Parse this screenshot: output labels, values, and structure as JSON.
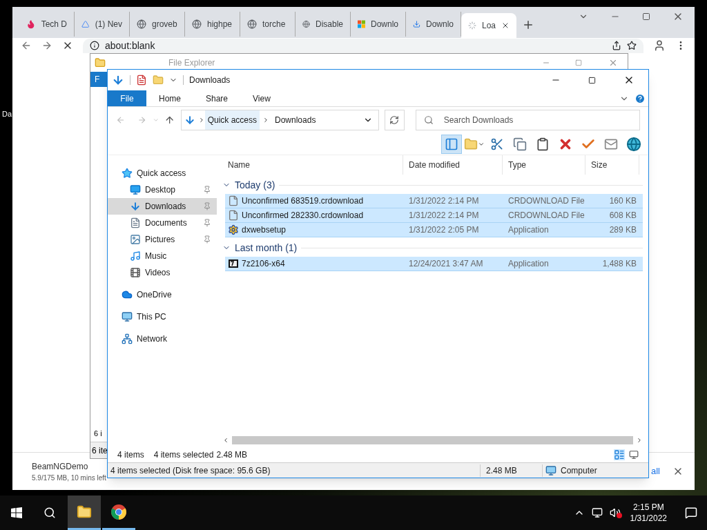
{
  "desktop": {
    "icon_label": "Da"
  },
  "browser": {
    "tabs": [
      {
        "title": "Tech D",
        "kind": "flame",
        "selected": false
      },
      {
        "title": "(1) Nev",
        "kind": "drive",
        "selected": false
      },
      {
        "title": "groveb",
        "kind": "globe",
        "selected": false
      },
      {
        "title": "highpe",
        "kind": "globe",
        "selected": false
      },
      {
        "title": "torche",
        "kind": "globe",
        "selected": false
      },
      {
        "title": "Disable",
        "kind": "globe",
        "selected": false
      },
      {
        "title": "Downlo",
        "kind": "windows",
        "selected": false
      },
      {
        "title": "Downlo",
        "kind": "download",
        "selected": false
      },
      {
        "title": "Loa",
        "kind": "spinner",
        "selected": true
      }
    ],
    "address": "about:blank",
    "download": {
      "name": "BeamNGDemo",
      "progress": "5.9/175 MB, 10 mins left",
      "show_all": "all"
    }
  },
  "back_window": {
    "title": "File Explorer",
    "file_tab": "F",
    "list_text": "6 i",
    "status": "6 ite"
  },
  "explorer": {
    "title": "Downloads",
    "ribbon_tabs": [
      {
        "label": "File",
        "selected": true
      },
      {
        "label": "Home",
        "selected": false
      },
      {
        "label": "Share",
        "selected": false
      },
      {
        "label": "View",
        "selected": false
      }
    ],
    "breadcrumbs": [
      "Quick access",
      "Downloads"
    ],
    "search": {
      "placeholder": "Search Downloads"
    },
    "toolbar": [
      {
        "kind": "pane",
        "selected": true
      },
      {
        "kind": "properties",
        "selected": false
      },
      {
        "kind": "cut",
        "selected": false
      },
      {
        "kind": "copy",
        "selected": false
      },
      {
        "kind": "paste",
        "selected": false
      },
      {
        "kind": "delete",
        "selected": false
      },
      {
        "kind": "check",
        "selected": false
      },
      {
        "kind": "rename",
        "selected": false
      },
      {
        "kind": "globe",
        "selected": false
      }
    ],
    "nav": [
      {
        "label": "Quick access",
        "kind": "star",
        "selected": false,
        "children": [
          {
            "label": "Desktop",
            "kind": "desktop",
            "pinned": true,
            "selected": false
          },
          {
            "label": "Downloads",
            "kind": "download",
            "pinned": true,
            "selected": true
          },
          {
            "label": "Documents",
            "kind": "documents",
            "pinned": true,
            "selected": false
          },
          {
            "label": "Pictures",
            "kind": "pictures",
            "pinned": true,
            "selected": false
          },
          {
            "label": "Music",
            "kind": "music",
            "pinned": false,
            "selected": false
          },
          {
            "label": "Videos",
            "kind": "videos",
            "pinned": false,
            "selected": false
          }
        ]
      },
      {
        "label": "OneDrive",
        "kind": "cloud",
        "selected": false
      },
      {
        "label": "This PC",
        "kind": "pc",
        "selected": false
      },
      {
        "label": "Network",
        "kind": "network",
        "selected": false
      }
    ],
    "columns": [
      "Name",
      "Date modified",
      "Type",
      "Size"
    ],
    "groups": [
      {
        "label": "Today (3)",
        "expanded": true,
        "files": [
          {
            "name": "Unconfirmed 683519.crdownload",
            "date": "1/31/2022 2:14 PM",
            "type": "CRDOWNLOAD File",
            "size": "160 KB",
            "kind": "blank",
            "selected": true
          },
          {
            "name": "Unconfirmed 282330.crdownload",
            "date": "1/31/2022 2:14 PM",
            "type": "CRDOWNLOAD File",
            "size": "608 KB",
            "kind": "blank",
            "selected": true
          },
          {
            "name": "dxwebsetup",
            "date": "1/31/2022 2:05 PM",
            "type": "Application",
            "size": "289 KB",
            "kind": "setup",
            "selected": true
          }
        ]
      },
      {
        "label": "Last month (1)",
        "expanded": true,
        "files": [
          {
            "name": "7z2106-x64",
            "date": "12/24/2021 3:47 AM",
            "type": "Application",
            "size": "1,488 KB",
            "kind": "sevenzip",
            "selected": true
          }
        ]
      }
    ],
    "status": {
      "count": "4 items",
      "selection": "4 items selected",
      "size": "2.48 MB"
    },
    "details_bar": {
      "summary": "4 items selected (Disk free space: 95.6 GB)",
      "size": "2.48 MB",
      "location": "Computer"
    }
  },
  "taskbar": {
    "apps": [
      {
        "kind": "explorer",
        "selected": true
      },
      {
        "kind": "chrome",
        "selected": false
      }
    ],
    "time": "2:15 PM",
    "date": "1/31/2022",
    "volume_muted": true
  }
}
